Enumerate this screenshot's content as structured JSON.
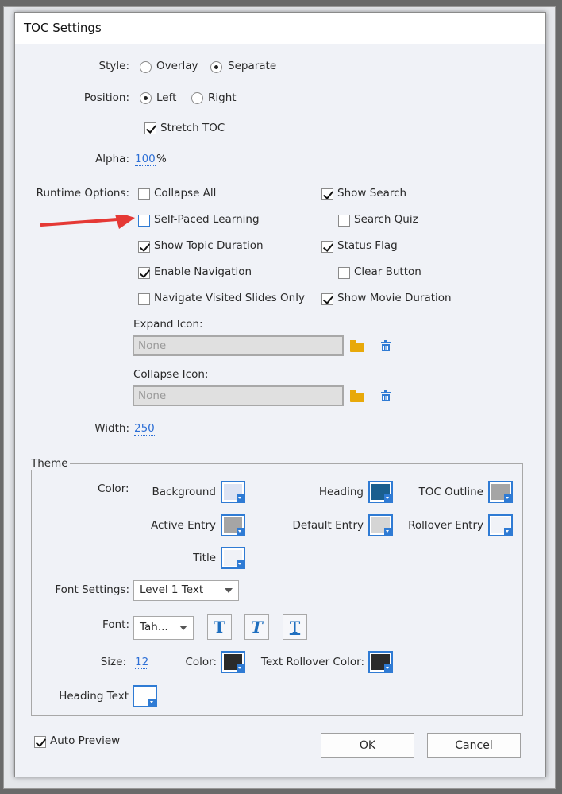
{
  "window": {
    "title": "TOC Settings"
  },
  "style": {
    "label": "Style:",
    "options": [
      "Overlay",
      "Separate"
    ],
    "selected": "Separate"
  },
  "position": {
    "label": "Position:",
    "options": [
      "Left",
      "Right"
    ],
    "selected": "Left"
  },
  "stretch_toc": {
    "label": "Stretch TOC",
    "checked": true
  },
  "alpha": {
    "label": "Alpha:",
    "value": "100",
    "unit": "%"
  },
  "runtime": {
    "label": "Runtime Options:",
    "options": [
      {
        "label": "Collapse All",
        "checked": false
      },
      {
        "label": "Show Search",
        "checked": true
      },
      {
        "label": "Self-Paced Learning",
        "checked": false
      },
      {
        "label": "Search Quiz",
        "checked": false
      },
      {
        "label": "Show Topic Duration",
        "checked": true
      },
      {
        "label": "Status Flag",
        "checked": true
      },
      {
        "label": "Enable Navigation",
        "checked": true
      },
      {
        "label": "Clear Button",
        "checked": false
      },
      {
        "label": "Navigate Visited Slides Only",
        "checked": false
      },
      {
        "label": "Show Movie Duration",
        "checked": true
      }
    ]
  },
  "expand_icon": {
    "label": "Expand Icon:",
    "placeholder": "None"
  },
  "collapse_icon": {
    "label": "Collapse Icon:",
    "placeholder": "None"
  },
  "width": {
    "label": "Width:",
    "value": "250"
  },
  "theme": {
    "legend": "Theme",
    "color_label": "Color:",
    "swatches": [
      {
        "label": "Background",
        "color": "#dde3f3"
      },
      {
        "label": "Heading",
        "color": "#1a5f8f"
      },
      {
        "label": "TOC Outline",
        "color": "#a5a5a5"
      },
      {
        "label": "Active Entry",
        "color": "#a5a5a5"
      },
      {
        "label": "Default Entry",
        "color": "#d5d5d5"
      },
      {
        "label": "Rollover Entry",
        "color": "#f0f2f7"
      },
      {
        "label": "Title",
        "color": "#f0f2f7"
      }
    ],
    "font_settings": {
      "label": "Font Settings:",
      "value": "Level 1 Text"
    },
    "font": {
      "label": "Font:",
      "value": "Tah...",
      "styles": [
        "T",
        "T",
        "T"
      ]
    },
    "size": {
      "label": "Size:",
      "value": "12"
    },
    "text_color": {
      "label": "Color:",
      "color": "#2b2b2b"
    },
    "text_rollover": {
      "label": "Text Rollover Color:",
      "color": "#2b2b2b"
    },
    "heading_text": {
      "label": "Heading Text",
      "color": "#ffffff"
    }
  },
  "auto_preview": {
    "label": "Auto Preview",
    "checked": true
  },
  "buttons": {
    "ok": "OK",
    "cancel": "Cancel"
  },
  "annotation": {
    "arrow_color": "#e53935"
  }
}
